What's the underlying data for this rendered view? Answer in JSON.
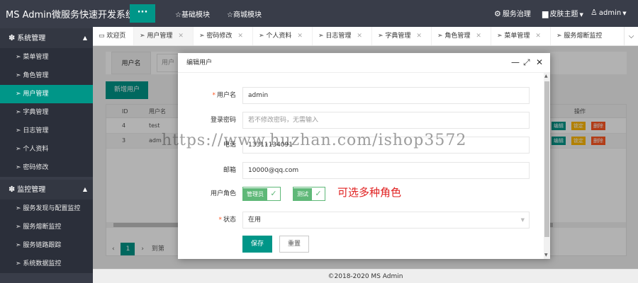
{
  "header": {
    "logo": "MS Admin微服务快速开发系统",
    "menu_toggle": "···",
    "nav": [
      "☆基础模块",
      "☆商城模块"
    ],
    "right": {
      "service_gov": "服务治理",
      "skin": "皮肤主题",
      "user": "admin"
    }
  },
  "sidebar": {
    "groups": [
      {
        "title": "系统管理",
        "items": [
          "➣ 菜单管理",
          "➣ 角色管理",
          "➣ 用户管理",
          "➣ 字典管理",
          "➣ 日志管理",
          "➣ 个人资料",
          "➣ 密码修改"
        ]
      },
      {
        "title": "监控管理",
        "items": [
          "➣ 服务发现与配置监控",
          "➣ 服务熔断监控",
          "➣ 服务链路跟踪",
          "➣ 系统数据监控"
        ]
      }
    ],
    "active_item": "➣ 用户管理"
  },
  "tabs": [
    {
      "label": "欢迎页"
    },
    {
      "label": "➣ 用户管理"
    },
    {
      "label": "➣ 密码修改"
    },
    {
      "label": "➣ 个人资料"
    },
    {
      "label": "➣ 日志管理"
    },
    {
      "label": "➣ 字典管理"
    },
    {
      "label": "➣ 角色管理"
    },
    {
      "label": "➣ 菜单管理"
    },
    {
      "label": "➣ 服务熔断监控"
    }
  ],
  "page": {
    "search_label": "用户名",
    "search_value": "用户",
    "new_button": "新增用户",
    "table": {
      "headers": [
        "ID",
        "用户名",
        "操作"
      ],
      "rows": [
        {
          "id": "4",
          "name": "test"
        },
        {
          "id": "3",
          "name": "adm"
        }
      ],
      "ops": [
        "编辑",
        "锁定",
        "删除"
      ]
    },
    "pager": {
      "current": "1",
      "goto": "到第"
    }
  },
  "footer": "©2018-2020 MS Admin",
  "modal": {
    "title": "编辑用户",
    "fields": {
      "username": {
        "label": "用户名",
        "value": "admin"
      },
      "password": {
        "label": "登录密码",
        "placeholder": "若不修改密码，无需输入"
      },
      "phone": {
        "label": "电话",
        "value": "13311134091"
      },
      "email": {
        "label": "邮箱",
        "value": "10000@qq.com"
      },
      "roles": {
        "label": "用户角色",
        "options": [
          "管理员",
          "测试"
        ]
      },
      "status": {
        "label": "状态",
        "value": "在用"
      }
    },
    "annotation": "可选多种角色",
    "save": "保存",
    "reset": "重置"
  },
  "watermark": "https://www.huzhan.com/ishop3572"
}
